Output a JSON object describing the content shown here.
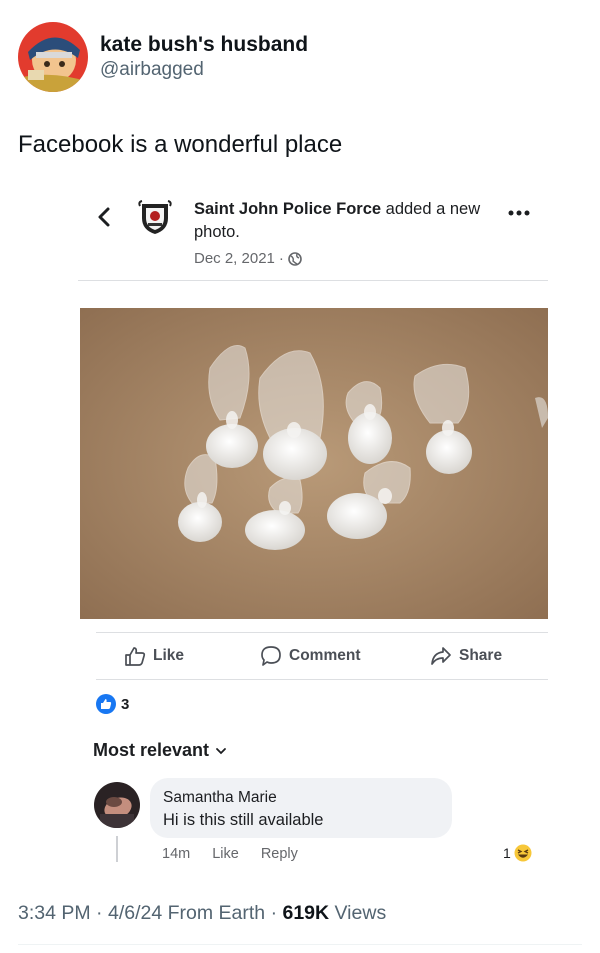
{
  "tweet": {
    "display_name": "kate bush's husband",
    "handle": "@airbagged",
    "text": "Facebook is a wonderful place",
    "time": "3:34 PM",
    "date": "4/6/24",
    "source": "From Earth",
    "views_count": "619K",
    "views_label": "Views"
  },
  "fb_post": {
    "page_name": "Saint John Police Force",
    "action_text": "added a new photo.",
    "date": "Dec 2, 2021",
    "actions": {
      "like": "Like",
      "comment": "Comment",
      "share": "Share"
    },
    "reaction_count": "3",
    "sort_label": "Most relevant",
    "comment": {
      "author": "Samantha Marie",
      "text": "Hi is this still available",
      "time": "14m",
      "like": "Like",
      "reply": "Reply",
      "reaction_count": "1"
    }
  },
  "colors": {
    "facebook_blue": "#1877f2",
    "secondary_text": "#65676b",
    "twitter_secondary": "#536471"
  }
}
